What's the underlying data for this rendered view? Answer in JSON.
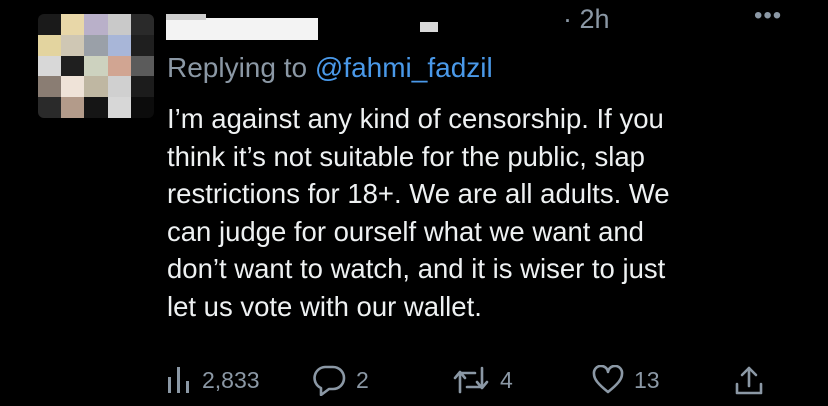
{
  "tweet": {
    "time": "2h",
    "more_glyph": "•••",
    "replying_prefix": "Replying to ",
    "replying_handle": "@fahmi_fadzil",
    "body_lines": [
      "I’m against any kind of censorship. If you",
      "think it’s not suitable for the public, slap",
      "restrictions for 18+. We are all adults. We",
      "can judge for ourself what we want and",
      "don’t want to watch, and it is wiser to just",
      "let us vote with our wallet."
    ]
  },
  "actions": {
    "views": {
      "icon": "bar-chart-icon",
      "count": "2,833"
    },
    "reply": {
      "icon": "reply-bubble-icon",
      "count": "2"
    },
    "retweet": {
      "icon": "retweet-icon",
      "count": "4"
    },
    "like": {
      "icon": "heart-icon",
      "count": "13"
    },
    "share": {
      "icon": "share-icon"
    }
  },
  "colors": {
    "background": "#000000",
    "text": "#e7e9ea",
    "secondary": "#8b98a5",
    "link": "#4a99e9"
  }
}
